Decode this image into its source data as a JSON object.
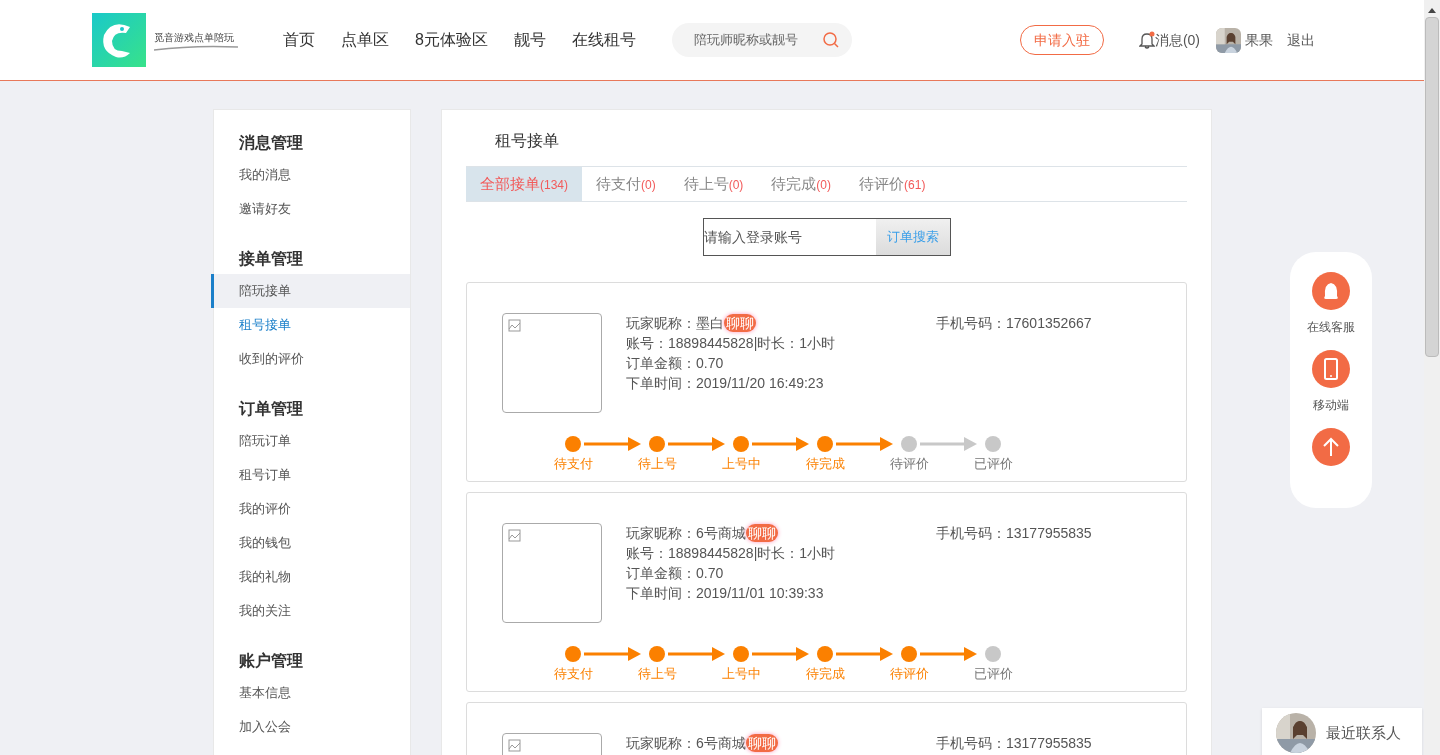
{
  "header": {
    "logo_text": "觅音游戏点单陪玩",
    "nav": [
      {
        "label": "首页"
      },
      {
        "label": "点单区"
      },
      {
        "label": "8元体验区"
      },
      {
        "label": "靓号"
      },
      {
        "label": "在线租号"
      }
    ],
    "search": {
      "placeholder": "陪玩师昵称或靓号"
    },
    "apply_button": "申请入驻",
    "messages": {
      "label": "消息(0)",
      "unread": true
    },
    "user": "果果",
    "logout": "退出"
  },
  "sidebar": [
    {
      "title": "消息管理",
      "items": [
        {
          "label": "我的消息",
          "selected": false,
          "hovered": false
        },
        {
          "label": "邀请好友",
          "selected": false,
          "hovered": false
        }
      ]
    },
    {
      "title": "接单管理",
      "items": [
        {
          "label": "陪玩接单",
          "selected": false,
          "hovered": true
        },
        {
          "label": "租号接单",
          "selected": true,
          "hovered": false
        },
        {
          "label": "收到的评价",
          "selected": false,
          "hovered": false
        }
      ]
    },
    {
      "title": "订单管理",
      "items": [
        {
          "label": "陪玩订单",
          "selected": false,
          "hovered": false
        },
        {
          "label": "租号订单",
          "selected": false,
          "hovered": false
        },
        {
          "label": "我的评价",
          "selected": false,
          "hovered": false
        },
        {
          "label": "我的钱包",
          "selected": false,
          "hovered": false
        },
        {
          "label": "我的礼物",
          "selected": false,
          "hovered": false
        },
        {
          "label": "我的关注",
          "selected": false,
          "hovered": false
        }
      ]
    },
    {
      "title": "账户管理",
      "items": [
        {
          "label": "基本信息",
          "selected": false,
          "hovered": false
        },
        {
          "label": "加入公会",
          "selected": false,
          "hovered": false
        }
      ]
    }
  ],
  "main": {
    "title": "租号接单",
    "tabs": [
      {
        "label": "全部接单",
        "count": "(134)",
        "selected": true
      },
      {
        "label": "待支付",
        "count": "(0)",
        "selected": false
      },
      {
        "label": "待上号",
        "count": "(0)",
        "selected": false
      },
      {
        "label": "待完成",
        "count": "(0)",
        "selected": false
      },
      {
        "label": "待评价",
        "count": "(61)",
        "selected": false
      }
    ],
    "search": {
      "placeholder": "请输入登录账号",
      "button": "订单搜索"
    },
    "orders": [
      {
        "nickname": "玩家昵称：墨白",
        "chat": "聊聊",
        "account": "账号：18898445828|时长：1小时",
        "amount": "订单金额：0.70",
        "time": "下单时间：2019/11/20 16:49:23",
        "phone": "手机号码：17601352667",
        "steps": [
          {
            "label": "待支付",
            "done": true
          },
          {
            "label": "待上号",
            "done": true
          },
          {
            "label": "上号中",
            "done": true
          },
          {
            "label": "待完成",
            "done": true
          },
          {
            "label": "待评价",
            "done": false
          },
          {
            "label": "已评价",
            "done": false
          }
        ]
      },
      {
        "nickname": "玩家昵称：6号商城",
        "chat": "聊聊",
        "account": "账号：18898445828|时长：1小时",
        "amount": "订单金额：0.70",
        "time": "下单时间：2019/11/01 10:39:33",
        "phone": "手机号码：13177955835",
        "steps": [
          {
            "label": "待支付",
            "done": true
          },
          {
            "label": "待上号",
            "done": true
          },
          {
            "label": "上号中",
            "done": true
          },
          {
            "label": "待完成",
            "done": true
          },
          {
            "label": "待评价",
            "done": true
          },
          {
            "label": "已评价",
            "done": false
          }
        ]
      },
      {
        "nickname": "玩家昵称：6号商城",
        "chat": "聊聊",
        "phone": "手机号码：13177955835"
      }
    ]
  },
  "float_panel": [
    {
      "kind": "service",
      "label": "在线客服"
    },
    {
      "kind": "mobile",
      "label": "移动端"
    },
    {
      "kind": "top"
    }
  ],
  "recent_contacts": "最近联系人"
}
